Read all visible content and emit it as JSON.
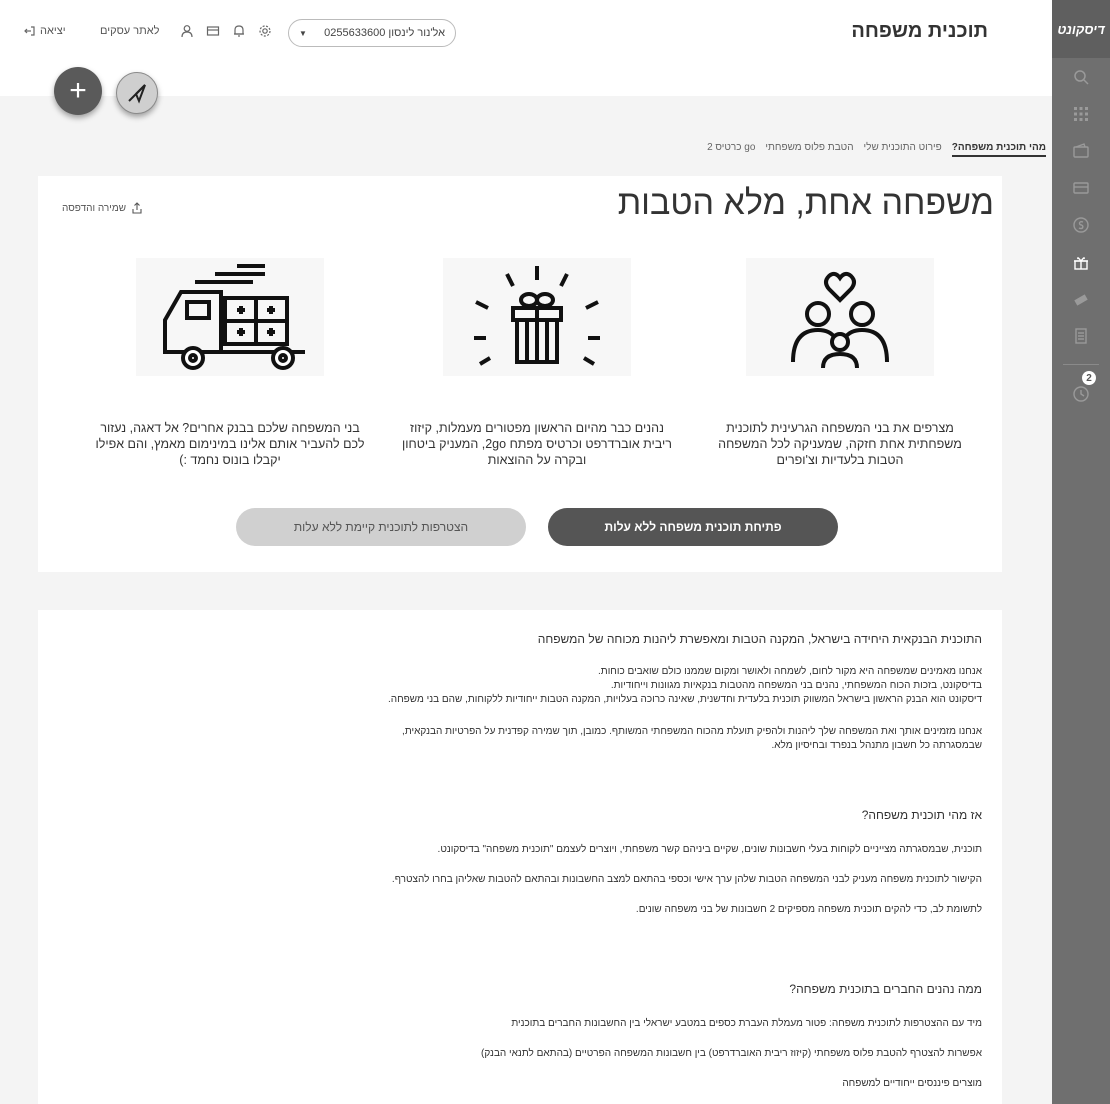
{
  "sidebar": {
    "logo": "דיסקונט",
    "badge": "2"
  },
  "header": {
    "title": "תוכנית משפחה",
    "account": "אל'נור לינסון 0255633600",
    "biz": "לאתר עסקים",
    "logout": "יציאה"
  },
  "tabs": [
    "מהי תוכנית משפחה?",
    "פירוט התוכנית שלי",
    "הטבת פלוס משפחתי",
    "go כרטיס 2"
  ],
  "hero": {
    "headline": "משפחה אחת, מלא הטבות",
    "save": "שמירה והדפסה",
    "features": [
      "מצרפים את בני המשפחה הגרעינית לתוכנית משפחתית אחת חזקה, שמעניקה לכל המשפחה הטבות בלעדיות וצ'ופרים",
      "נהנים כבר מהיום הראשון מפטורים מעמלות, קיזוז ריבית אוברדרפט וכרטיס מפתח 2go, המעניק ביטחון ובקרה על ההוצאות",
      "בני המשפחה שלכם בבנק אחרים? אל דאגה, נעזור לכם להעביר אותם אלינו במינימום מאמץ, והם אפילו יקבלו בונוס נחמד :)"
    ],
    "primary_btn": "פתיחת תוכנית משפחה ללא עלות",
    "secondary_btn": "הצטרפות לתוכנית קיימת ללא עלות"
  },
  "body": {
    "heading1": "התוכנית הבנקאית היחידה בישראל, המקנה הטבות ומאפשרת ליהנות מכוחה של המשפחה",
    "p1": "אנחנו מאמינים שמשפחה היא מקור לחום, לשמחה ולאושר ומקום שממנו כולם שואבים כוחות.",
    "p2": "בדיסקונט, בזכות הכוח המשפחתי, נהנים בני המשפחה מהטבות בנקאיות מגוונות וייחודיות.",
    "p3": "דיסקונט הוא הבנק הראשון בישראל המשווק תוכנית בלעדית וחדשנית, שאינה כרוכה בעלויות, המקנה הטבות ייחודיות ללקוחות, שהם בני משפחה.",
    "p4": "אנחנו מזמינים אותך ואת המשפחה שלך ליהנות ולהפיק תועלת מהכוח המשפחתי המשותף. כמובן, תוך שמירה קפדנית על הפרטיות הבנקאית,",
    "p5": "שבמסגרתה כל חשבון מתנהל בנפרד ובחיסיון מלא.",
    "heading2": "אז מהי תוכנית משפחה?",
    "p6": "תוכנית, שבמסגרתה מצייניים לקוחות בעלי חשבונות שונים, שקיים ביניהם קשר משפחתי, ויוצרים לעצמם \"תוכנית משפחה\" בדיסקונט.",
    "p7": "הקישור לתוכנית משפחה מעניק לבני המשפחה הטבות שלהן ערך אישי וכספי בהתאם למצב החשבונות ובהתאם להטבות שאליהן בחרו להצטרף.",
    "p8": "לתשומת לב, כדי להקים תוכנית משפחה מספיקים 2 חשבונות של בני משפחה שונים.",
    "heading3": "ממה נהנים החברים בתוכנית משפחה?",
    "p9": "מיד עם ההצטרפות לתוכנית משפחה: פטור מעמלת העברת כספים במטבע ישראלי בין החשבונות החברים בתוכנית",
    "p10": "אפשרות להצטרף להטבת פלוס משפחתי (קיזוז ריבית האוברדרפט) בין חשבונות המשפחה הפרטיים (בהתאם לתנאי הבנק)",
    "p11": "מוצרים פיננסים ייחודיים למשפחה"
  }
}
